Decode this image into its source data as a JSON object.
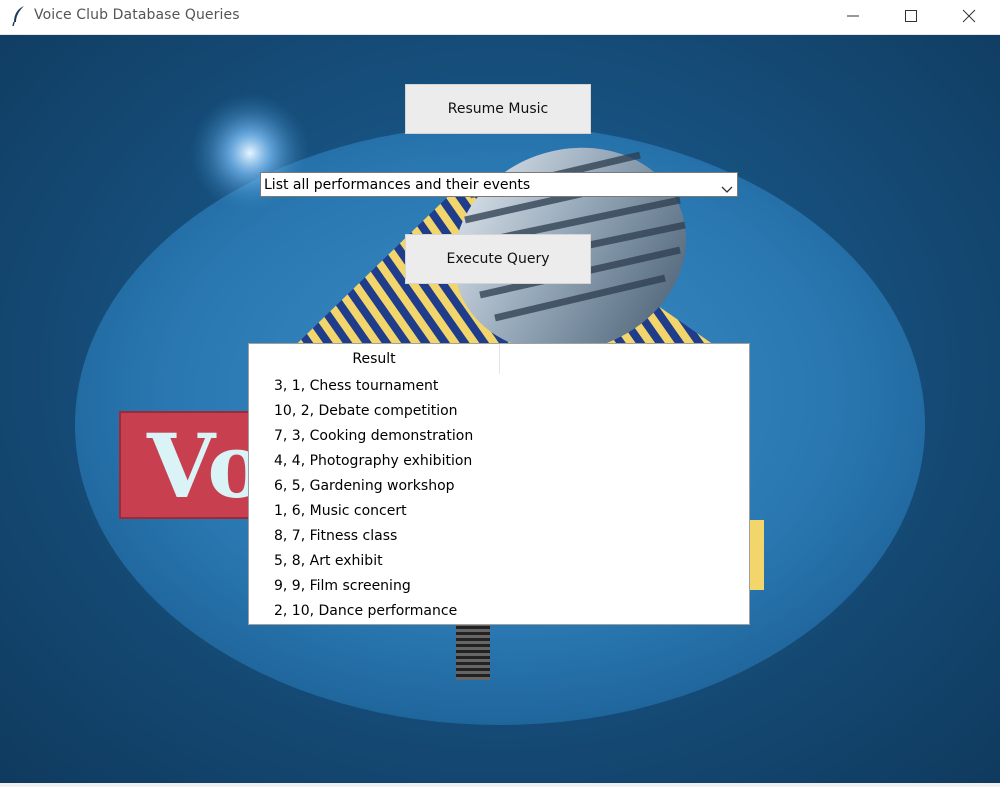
{
  "window": {
    "title": "Voice Club Database Queries"
  },
  "controls": {
    "resume_label": "Resume Music",
    "query_selected": "List all performances and their events",
    "execute_label": "Execute Query"
  },
  "table": {
    "columns": [
      "Result",
      ""
    ],
    "rows": [
      "3, 1, Chess tournament",
      "10, 2, Debate competition",
      "7, 3, Cooking demonstration",
      "4, 4, Photography exhibition",
      "6, 5, Gardening workshop",
      "1, 6, Music concert",
      "8, 7, Fitness class",
      "5, 8, Art exhibit",
      "9, 9, Film screening",
      "2, 10, Dance performance"
    ]
  },
  "background": {
    "logo_text": "Vo",
    "colors": {
      "backdrop": "#17517f",
      "ellipse": "#2a78b2",
      "sign": "#c8404f",
      "stripe_yellow": "#f2d56b"
    }
  }
}
